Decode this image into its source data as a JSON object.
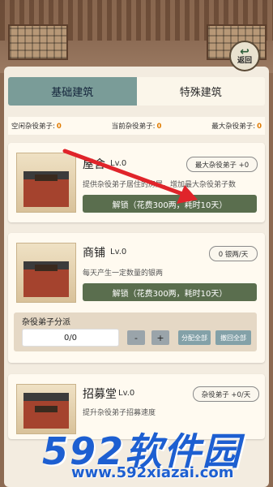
{
  "nav": {
    "back_label": "返回"
  },
  "tabs": [
    {
      "label": "基础建筑",
      "active": true
    },
    {
      "label": "特殊建筑",
      "active": false
    }
  ],
  "stats": {
    "idle_label": "空闲杂役弟子:",
    "idle_value": "0",
    "current_label": "当前杂役弟子:",
    "current_value": "0",
    "max_label": "最大杂役弟子:",
    "max_value": "0"
  },
  "buildings": [
    {
      "name": "屋舍",
      "level": "Lv.0",
      "desc": "提供杂役弟子居住的房屋，增加最大杂役弟子数",
      "badge": "最大杂役弟子 +0",
      "action": "解锁（花费300两，耗时10天）"
    },
    {
      "name": "商铺",
      "level": "Lv.0",
      "desc": "每天产生一定数量的银两",
      "badge": "0 银两/天",
      "action": "解锁（花费300两，耗时10天）",
      "assign": {
        "label": "杂役弟子分派",
        "value": "0/0",
        "minus": "-",
        "plus": "+",
        "assign_all": "分配全部",
        "recall_all": "撤回全部"
      }
    },
    {
      "name": "招募堂",
      "level": "Lv.0",
      "desc": "提升杂役弟子招募速度",
      "badge": "杂役弟子 +0/天"
    }
  ],
  "watermark": {
    "brand": "592软件园",
    "url": "www.592xiazai.com"
  },
  "colors": {
    "accent_tab": "#7a9c98",
    "action_btn": "#5a6e4e",
    "highlight": "#e07b00"
  }
}
